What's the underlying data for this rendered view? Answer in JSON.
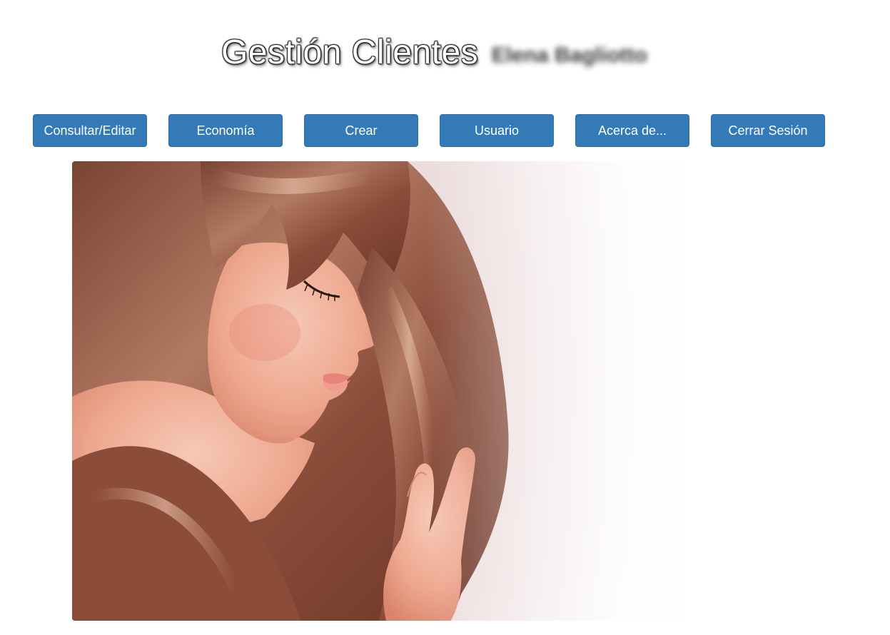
{
  "header": {
    "title": "Gestión Clientes",
    "user_name": "Elena Bagliotto"
  },
  "nav": {
    "buttons": [
      {
        "label": "Consultar/Editar"
      },
      {
        "label": "Economía"
      },
      {
        "label": "Crear"
      },
      {
        "label": "Usuario"
      },
      {
        "label": "Acerca de..."
      },
      {
        "label": "Cerrar Sesión"
      }
    ]
  },
  "colors": {
    "button_bg": "#337ab7",
    "button_border": "#2e6da4",
    "button_text": "#ffffff",
    "page_bg": "#ffffff"
  },
  "hero": {
    "subject": "woman-with-long-brown-hair-photo"
  }
}
